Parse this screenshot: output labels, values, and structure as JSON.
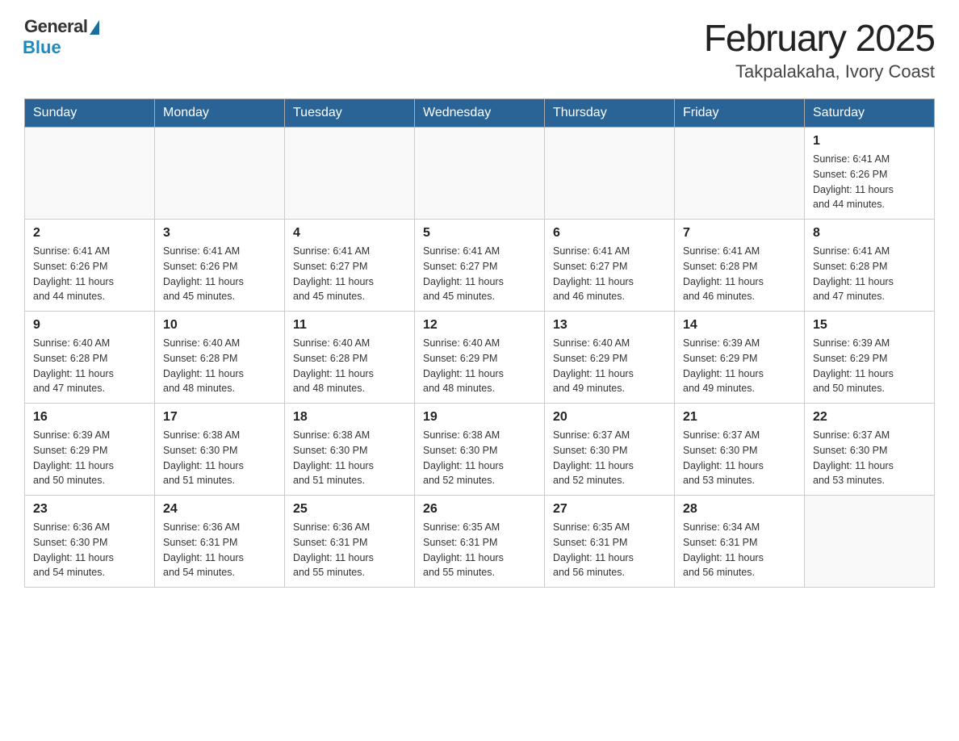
{
  "header": {
    "logo_general": "General",
    "logo_blue": "Blue",
    "month_title": "February 2025",
    "location": "Takpalakaha, Ivory Coast"
  },
  "weekdays": [
    "Sunday",
    "Monday",
    "Tuesday",
    "Wednesday",
    "Thursday",
    "Friday",
    "Saturday"
  ],
  "weeks": [
    [
      {
        "day": "",
        "info": ""
      },
      {
        "day": "",
        "info": ""
      },
      {
        "day": "",
        "info": ""
      },
      {
        "day": "",
        "info": ""
      },
      {
        "day": "",
        "info": ""
      },
      {
        "day": "",
        "info": ""
      },
      {
        "day": "1",
        "info": "Sunrise: 6:41 AM\nSunset: 6:26 PM\nDaylight: 11 hours\nand 44 minutes."
      }
    ],
    [
      {
        "day": "2",
        "info": "Sunrise: 6:41 AM\nSunset: 6:26 PM\nDaylight: 11 hours\nand 44 minutes."
      },
      {
        "day": "3",
        "info": "Sunrise: 6:41 AM\nSunset: 6:26 PM\nDaylight: 11 hours\nand 45 minutes."
      },
      {
        "day": "4",
        "info": "Sunrise: 6:41 AM\nSunset: 6:27 PM\nDaylight: 11 hours\nand 45 minutes."
      },
      {
        "day": "5",
        "info": "Sunrise: 6:41 AM\nSunset: 6:27 PM\nDaylight: 11 hours\nand 45 minutes."
      },
      {
        "day": "6",
        "info": "Sunrise: 6:41 AM\nSunset: 6:27 PM\nDaylight: 11 hours\nand 46 minutes."
      },
      {
        "day": "7",
        "info": "Sunrise: 6:41 AM\nSunset: 6:28 PM\nDaylight: 11 hours\nand 46 minutes."
      },
      {
        "day": "8",
        "info": "Sunrise: 6:41 AM\nSunset: 6:28 PM\nDaylight: 11 hours\nand 47 minutes."
      }
    ],
    [
      {
        "day": "9",
        "info": "Sunrise: 6:40 AM\nSunset: 6:28 PM\nDaylight: 11 hours\nand 47 minutes."
      },
      {
        "day": "10",
        "info": "Sunrise: 6:40 AM\nSunset: 6:28 PM\nDaylight: 11 hours\nand 48 minutes."
      },
      {
        "day": "11",
        "info": "Sunrise: 6:40 AM\nSunset: 6:28 PM\nDaylight: 11 hours\nand 48 minutes."
      },
      {
        "day": "12",
        "info": "Sunrise: 6:40 AM\nSunset: 6:29 PM\nDaylight: 11 hours\nand 48 minutes."
      },
      {
        "day": "13",
        "info": "Sunrise: 6:40 AM\nSunset: 6:29 PM\nDaylight: 11 hours\nand 49 minutes."
      },
      {
        "day": "14",
        "info": "Sunrise: 6:39 AM\nSunset: 6:29 PM\nDaylight: 11 hours\nand 49 minutes."
      },
      {
        "day": "15",
        "info": "Sunrise: 6:39 AM\nSunset: 6:29 PM\nDaylight: 11 hours\nand 50 minutes."
      }
    ],
    [
      {
        "day": "16",
        "info": "Sunrise: 6:39 AM\nSunset: 6:29 PM\nDaylight: 11 hours\nand 50 minutes."
      },
      {
        "day": "17",
        "info": "Sunrise: 6:38 AM\nSunset: 6:30 PM\nDaylight: 11 hours\nand 51 minutes."
      },
      {
        "day": "18",
        "info": "Sunrise: 6:38 AM\nSunset: 6:30 PM\nDaylight: 11 hours\nand 51 minutes."
      },
      {
        "day": "19",
        "info": "Sunrise: 6:38 AM\nSunset: 6:30 PM\nDaylight: 11 hours\nand 52 minutes."
      },
      {
        "day": "20",
        "info": "Sunrise: 6:37 AM\nSunset: 6:30 PM\nDaylight: 11 hours\nand 52 minutes."
      },
      {
        "day": "21",
        "info": "Sunrise: 6:37 AM\nSunset: 6:30 PM\nDaylight: 11 hours\nand 53 minutes."
      },
      {
        "day": "22",
        "info": "Sunrise: 6:37 AM\nSunset: 6:30 PM\nDaylight: 11 hours\nand 53 minutes."
      }
    ],
    [
      {
        "day": "23",
        "info": "Sunrise: 6:36 AM\nSunset: 6:30 PM\nDaylight: 11 hours\nand 54 minutes."
      },
      {
        "day": "24",
        "info": "Sunrise: 6:36 AM\nSunset: 6:31 PM\nDaylight: 11 hours\nand 54 minutes."
      },
      {
        "day": "25",
        "info": "Sunrise: 6:36 AM\nSunset: 6:31 PM\nDaylight: 11 hours\nand 55 minutes."
      },
      {
        "day": "26",
        "info": "Sunrise: 6:35 AM\nSunset: 6:31 PM\nDaylight: 11 hours\nand 55 minutes."
      },
      {
        "day": "27",
        "info": "Sunrise: 6:35 AM\nSunset: 6:31 PM\nDaylight: 11 hours\nand 56 minutes."
      },
      {
        "day": "28",
        "info": "Sunrise: 6:34 AM\nSunset: 6:31 PM\nDaylight: 11 hours\nand 56 minutes."
      },
      {
        "day": "",
        "info": ""
      }
    ]
  ]
}
